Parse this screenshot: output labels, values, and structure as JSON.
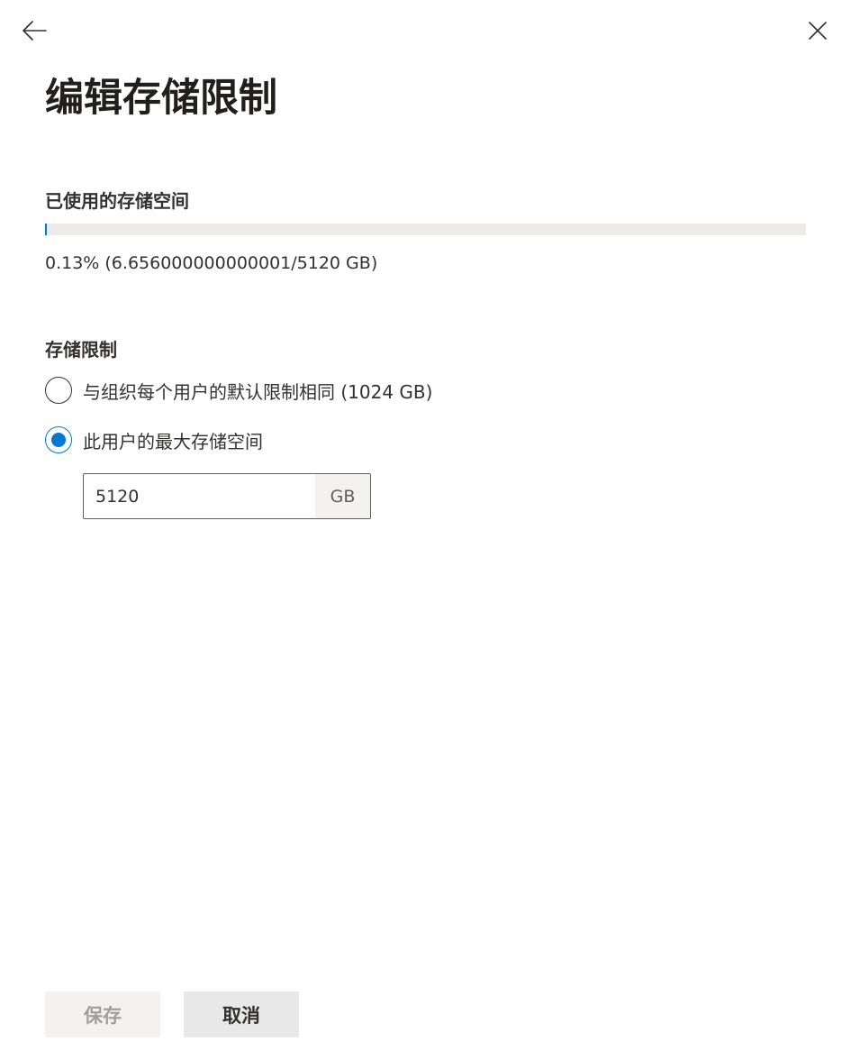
{
  "header": {
    "back_icon": "arrow-left-icon",
    "close_icon": "close-icon",
    "title": "编辑存储限制"
  },
  "usage": {
    "heading": "已使用的存储空间",
    "percent_used": 0.13,
    "summary": "0.13% (6.656000000000001/5120 GB)",
    "fill_color": "#0078d4"
  },
  "limit": {
    "heading": "存储限制",
    "options": [
      {
        "label": "与组织每个用户的默认限制相同 (1024 GB)",
        "selected": false
      },
      {
        "label": "此用户的最大存储空间",
        "selected": true
      }
    ],
    "input_value": "5120",
    "unit": "GB"
  },
  "footer": {
    "save_label": "保存",
    "save_enabled": false,
    "cancel_label": "取消"
  },
  "colors": {
    "accent": "#0078d4",
    "text": "#323130",
    "disabled_text": "#a19f9d"
  }
}
